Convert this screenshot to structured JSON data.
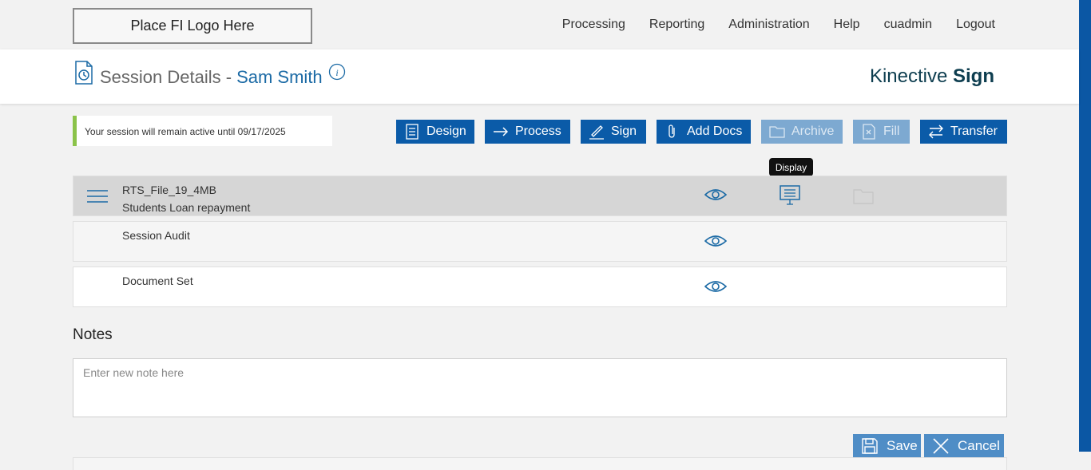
{
  "topbar": {
    "logo_text": "Place FI Logo Here",
    "nav": [
      "Processing",
      "Reporting",
      "Administration",
      "Help",
      "cuadmin",
      "Logout"
    ]
  },
  "header": {
    "title": "Session Details -",
    "name": "Sam Smith",
    "brand_light": "Kinective",
    "brand_bold": "Sign"
  },
  "notice": "Your session will remain active until 09/17/2025",
  "toolbar": {
    "design": "Design",
    "process": "Process",
    "sign": "Sign",
    "add_docs": "Add Docs",
    "archive": "Archive",
    "fill": "Fill",
    "transfer": "Transfer"
  },
  "tooltip": "Display",
  "documents": [
    {
      "line1": "RTS_File_19_4MB",
      "line2": "Students Loan repayment"
    },
    {
      "line1": "Session Audit",
      "line2": ""
    },
    {
      "line1": "Document Set",
      "line2": ""
    }
  ],
  "notes": {
    "label": "Notes",
    "placeholder": "Enter new note here",
    "save": "Save",
    "cancel": "Cancel"
  },
  "colors": {
    "accent": "#0b5ba8",
    "disabled": "#7da9d1",
    "notice_bar": "#8bc34a",
    "link": "#1b6aa5",
    "brand": "#0d3d4f"
  }
}
